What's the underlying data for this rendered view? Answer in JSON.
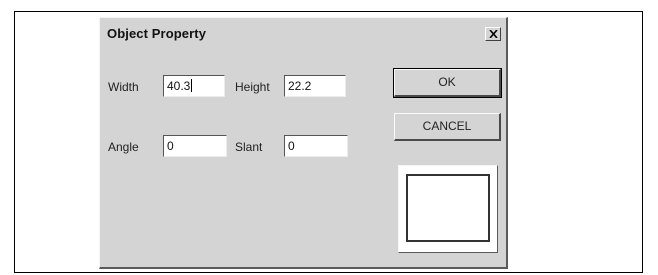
{
  "dialog": {
    "title": "Object Property",
    "close_icon": "close-x-icon"
  },
  "fields": {
    "width_label": "Width",
    "width_value": "40.3",
    "height_label": "Height",
    "height_value": "22.2",
    "angle_label": "Angle",
    "angle_value": "0",
    "slant_label": "Slant",
    "slant_value": "0"
  },
  "buttons": {
    "ok_label": "OK",
    "cancel_label": "CANCEL"
  },
  "colors": {
    "dialog_face": "#d4d4d4",
    "field_bg": "#ffffff"
  }
}
